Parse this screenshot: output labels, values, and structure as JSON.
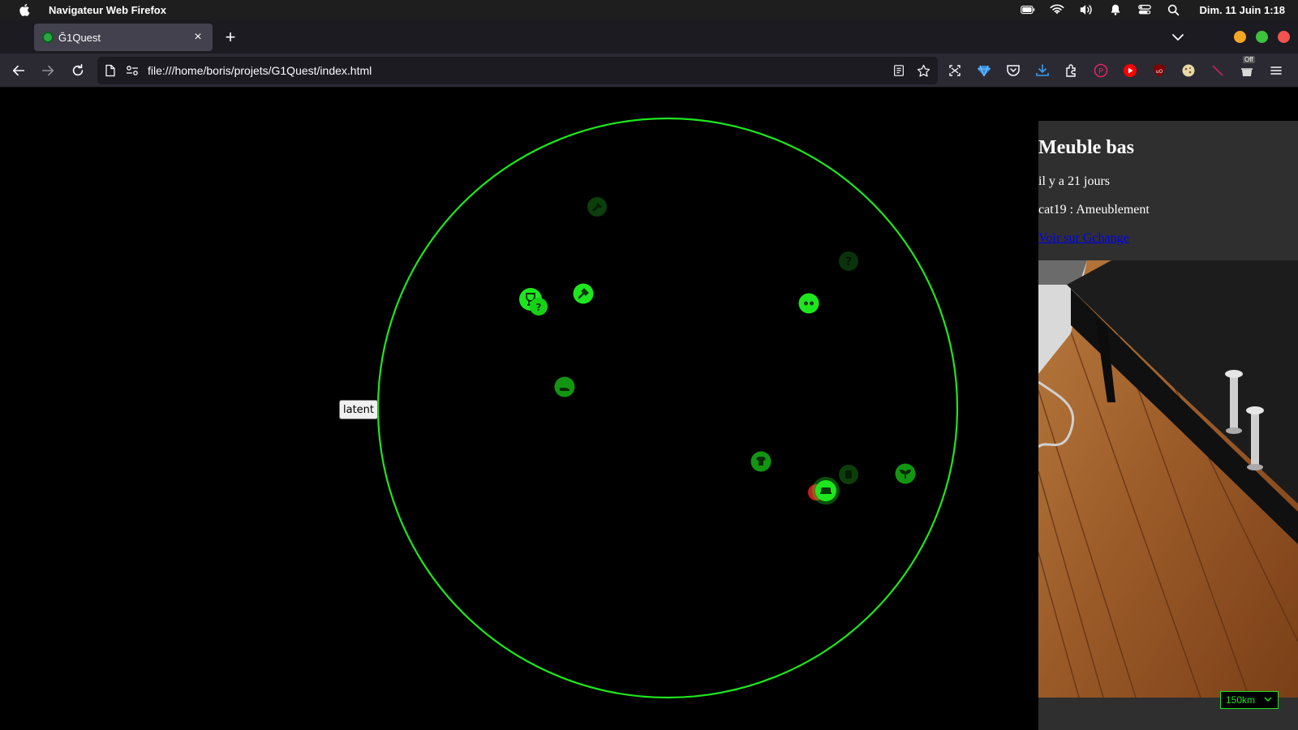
{
  "os": {
    "app_name": "Navigateur Web Firefox",
    "clock": "Dim. 11 Juin 1:18"
  },
  "browser": {
    "tab_title": "Ğ1Quest",
    "url": "file:///home/boris/projets/G1Quest/index.html",
    "tab_close": "×",
    "new_tab": "+",
    "ext_off_badge": "Off"
  },
  "page": {
    "latent_button": "latent",
    "radar_color": "#1ee61e",
    "markers": [
      {
        "icon": "flashlight-icon",
        "state": "dim"
      },
      {
        "icon": "question-icon",
        "state": "dim"
      },
      {
        "icon": "trophy-icon",
        "state": "bright"
      },
      {
        "icon": "question-icon",
        "state": "bright"
      },
      {
        "icon": "tool-icon",
        "state": "bright"
      },
      {
        "icon": "glasses-icon",
        "state": "bright"
      },
      {
        "icon": "shoe-icon",
        "state": "medium"
      },
      {
        "icon": "shirt-icon",
        "state": "medium"
      },
      {
        "icon": "jar-icon",
        "state": "dim"
      },
      {
        "icon": "plant-icon",
        "state": "medium"
      },
      {
        "icon": "furniture-icon",
        "state": "selected"
      }
    ],
    "detail": {
      "title": "Meuble bas",
      "age": "il y a 21 jours",
      "category": "cat19 : Ameublement",
      "link": "Voir sur Gchange"
    },
    "range_select": "150km"
  }
}
